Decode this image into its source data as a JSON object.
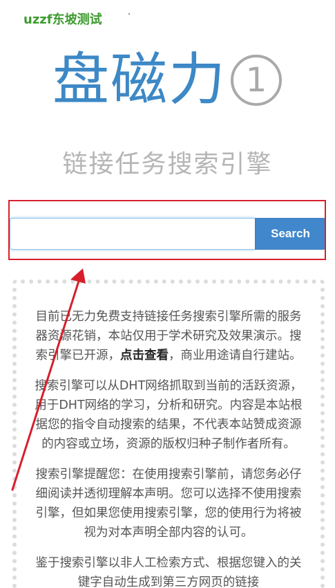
{
  "watermark": "uzzf东坡测试",
  "logo": {
    "text": "盘磁力",
    "circle_number": "1"
  },
  "tagline": "链接任务搜索引擎",
  "search": {
    "placeholder": "",
    "value": "",
    "button_label": "Search"
  },
  "info": {
    "p1_part1": "目前已无力免费支持链接任务搜索引擎所需的服务器资源花销，本站仅用于学术研究及效果演示。搜索引擎已开源，",
    "p1_link": "点击查看",
    "p1_part2": "，商业用途请自行建站。",
    "p2": "搜索引擎可以从DHT网络抓取到当前的活跃资源，用于DHT网络的学习，分析和研究。内容是本站根据您的指令自动搜索的结果，不代表本站赞成资源的内容或立场，资源的版权归种子制作者所有。",
    "p3": "搜索引擎提醒您：在使用搜索引擎前，请您务必仔细阅读并透彻理解本声明。您可以选择不使用搜索引擎，但如果您使用搜索引擎，您的使用行为将被视为对本声明全部内容的认可。",
    "p4": "鉴于搜索引擎以非人工检索方式、根据您键入的关键字自动生成到第三方网页的链接"
  },
  "colors": {
    "logo": "#3d88c6",
    "button": "#4187cc",
    "annotation": "#d61f2b",
    "watermark": "#3c9b2e"
  },
  "icons": {
    "logo_badge": "circled-number-icon",
    "annotation_arrow": "red-arrow-icon"
  }
}
